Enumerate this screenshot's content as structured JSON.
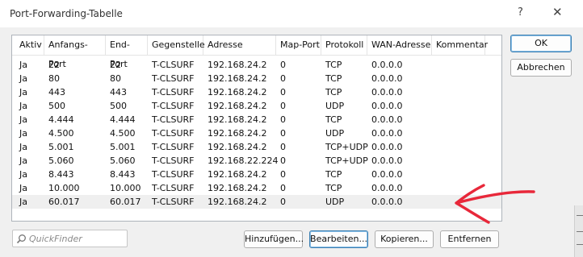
{
  "window": {
    "title": "Port-Forwarding-Tabelle",
    "help_glyph": "?",
    "close_glyph": "✕"
  },
  "table": {
    "headers": [
      "Aktiv",
      "Anfangs-Port",
      "End-Port",
      "Gegenstelle",
      "Adresse",
      "Map-Port",
      "Protokoll",
      "WAN-Adresse",
      "Kommentar"
    ],
    "rows": [
      [
        "Ja",
        "22",
        "22",
        "T-CLSURF",
        "192.168.24.2",
        "0",
        "TCP",
        "0.0.0.0",
        ""
      ],
      [
        "Ja",
        "80",
        "80",
        "T-CLSURF",
        "192.168.24.2",
        "0",
        "TCP",
        "0.0.0.0",
        ""
      ],
      [
        "Ja",
        "443",
        "443",
        "T-CLSURF",
        "192.168.24.2",
        "0",
        "TCP",
        "0.0.0.0",
        ""
      ],
      [
        "Ja",
        "500",
        "500",
        "T-CLSURF",
        "192.168.24.2",
        "0",
        "UDP",
        "0.0.0.0",
        ""
      ],
      [
        "Ja",
        "4.444",
        "4.444",
        "T-CLSURF",
        "192.168.24.2",
        "0",
        "TCP",
        "0.0.0.0",
        ""
      ],
      [
        "Ja",
        "4.500",
        "4.500",
        "T-CLSURF",
        "192.168.24.2",
        "0",
        "UDP",
        "0.0.0.0",
        ""
      ],
      [
        "Ja",
        "5.001",
        "5.001",
        "T-CLSURF",
        "192.168.24.2",
        "0",
        "TCP+UDP",
        "0.0.0.0",
        ""
      ],
      [
        "Ja",
        "5.060",
        "5.060",
        "T-CLSURF",
        "192.168.22.224",
        "0",
        "TCP+UDP",
        "0.0.0.0",
        ""
      ],
      [
        "Ja",
        "8.443",
        "8.443",
        "T-CLSURF",
        "192.168.24.2",
        "0",
        "TCP",
        "0.0.0.0",
        ""
      ],
      [
        "Ja",
        "10.000",
        "10.000",
        "T-CLSURF",
        "192.168.24.2",
        "0",
        "TCP",
        "0.0.0.0",
        ""
      ],
      [
        "Ja",
        "60.017",
        "60.017",
        "T-CLSURF",
        "192.168.24.2",
        "0",
        "UDP",
        "0.0.0.0",
        ""
      ]
    ],
    "selected_row": 10
  },
  "buttons": {
    "ok": "OK",
    "cancel": "Abbrechen",
    "add": "Hinzufügen...",
    "edit": "Bearbeiten...",
    "copy": "Kopieren...",
    "remove": "Entfernen"
  },
  "quickfinder": {
    "placeholder": "QuickFinder",
    "icon": "search-icon"
  },
  "annotation": {
    "color": "#e8283a",
    "icon": "red-arrow-annotation"
  },
  "colors": {
    "selected_row": "#efefef",
    "default_button_border": "#3c7fb1"
  }
}
